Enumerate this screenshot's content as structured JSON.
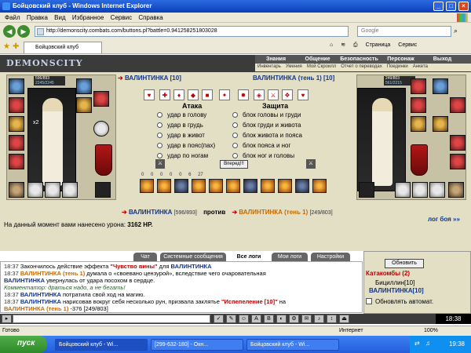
{
  "window": {
    "title": "Бойцовский клуб - Windows Internet Explorer"
  },
  "menu": [
    "Файл",
    "Правка",
    "Вид",
    "Избранное",
    "Сервис",
    "Справка"
  ],
  "address": {
    "url": "http://demonscity.combats.com/buttons.pl?battle=0.941258251803028",
    "search_placeholder": "Google"
  },
  "tab": {
    "label": "Бойцовский клуб"
  },
  "ie_buttons": {
    "page": "Страница",
    "tools": "Сервис"
  },
  "game": {
    "logo": "DEMONSCITY",
    "nav": [
      "Знания",
      "Общение",
      "Безопасность",
      "Персонаж",
      "Выход"
    ],
    "subnav": [
      "Инвентарь",
      "Умения",
      "Мой Скроилл",
      "Отчет о переводах",
      "Поединки",
      "Анкета"
    ]
  },
  "battle": {
    "left": {
      "name": "ВАЛИНТИНКА [10]",
      "hp": "596/893",
      "mana": "2245/2245",
      "hits": "x2"
    },
    "right": {
      "name": "ВАЛИНТИНКА (тень 1) [10]",
      "hp": "249/803",
      "mana": "561/2215"
    },
    "attack_header": "Атака",
    "defense_header": "Защита",
    "attack_options": [
      "удар в голову",
      "удар в грудь",
      "удар в живот",
      "удар в пояс(пах)",
      "удар по ногам"
    ],
    "defense_options": [
      "блок головы и груди",
      "блок груди и живота",
      "блок живота и пояса",
      "блок пояса и ног",
      "блок ног и головы"
    ],
    "forward_label": "Вперед!!!",
    "stats": [
      "0",
      "0",
      "0",
      "0",
      "0",
      "6",
      "27"
    ],
    "vs": {
      "p1": "ВАЛИНТИНКА",
      "p1_hp": "[596/893]",
      "vs_label": "против",
      "p2": "ВАЛИНТИНКА (тень 1)",
      "p2_hp": "[249/803]"
    },
    "damage_text": "На данный момент вами нанесено урона:",
    "damage_value": "3162 HP.",
    "log_link": "лог боя »»"
  },
  "chat_tabs": [
    "Чат",
    "Системные сообщения",
    "Все логи",
    "Мои логи",
    "Настройки"
  ],
  "chat": [
    {
      "time": "18:37",
      "text_pre": "Закончилось действие эффекта ",
      "em": "\"Чувство вины\"",
      "text_mid": " для ",
      "name": "ВАЛИНТИНКА"
    },
    {
      "time": "18:37",
      "name2": "ВАЛИНТИНКА (тень 1)",
      "text_post": " думала о «своевано цензурой», вследствие чего очаровательная"
    },
    {
      "name": "ВАЛИНТИНКА",
      "text_post": " увернулась от удара посохом в сердце."
    },
    {
      "comment": "Комментатор: драться надо, а не бегать!"
    },
    {
      "time": "18:37",
      "name": "ВАЛИНТИНКА",
      "text_post": " потратила свой ход на магию."
    },
    {
      "time": "18:37",
      "name": "ВАЛИНТИНКА",
      "text_post": " нарисовав вокруг себя несколько рун, призвала заклятье ",
      "em": "\"Испепеление [10]\"",
      "text_end": " на"
    },
    {
      "name2": "ВАЛИНТИНКА (тень 1)",
      "text_post": " -376 [249/803]"
    }
  ],
  "right_panel": {
    "refresh_label": "Обновить",
    "location": "Катакомбы (2)",
    "player1": "Бициллин[10]",
    "player2": "ВАЛИНТИНКА[10]",
    "auto_label": "Обновлять автомат."
  },
  "game_clock": "18:38",
  "status": {
    "left": "Готово",
    "zone": "Интернет",
    "zoom": "100%"
  },
  "taskbar": {
    "start": "пуск",
    "tasks": [
      "Бойцовский клуб - Wi...",
      "[299-632-180] - Окн...",
      "Бойцовский клуб - Wi..."
    ],
    "time": "19:38"
  }
}
